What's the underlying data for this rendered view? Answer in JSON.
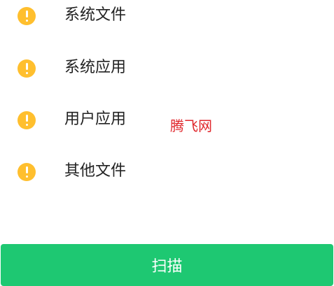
{
  "scan_list": {
    "items": [
      {
        "label": "系统文件",
        "icon": "warning-icon",
        "status": "warning"
      },
      {
        "label": "系统应用",
        "icon": "warning-icon",
        "status": "warning"
      },
      {
        "label": "用户应用",
        "icon": "warning-icon",
        "status": "warning"
      },
      {
        "label": "其他文件",
        "icon": "warning-icon",
        "status": "warning"
      }
    ]
  },
  "watermark": {
    "text": "腾飞网"
  },
  "scan_button": {
    "label": "扫描"
  },
  "colors": {
    "warning": "#ffbf2e",
    "primary_button": "#1ec872",
    "watermark": "#e0262b",
    "text": "#222222"
  }
}
